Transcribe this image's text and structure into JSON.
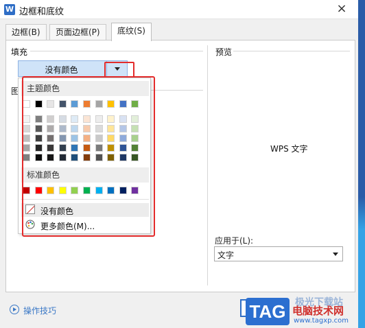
{
  "window": {
    "title": "边框和底纹",
    "app_icon_letter": "W",
    "close_glyph": "×"
  },
  "tabs": [
    {
      "label": "边框(B)",
      "active": false
    },
    {
      "label": "页面边框(P)",
      "active": false
    },
    {
      "label": "底纹(S)",
      "active": true
    }
  ],
  "fill": {
    "section_label": "填充",
    "selected_value": "没有颜色"
  },
  "pattern": {
    "section_label": "图"
  },
  "color_popup": {
    "theme_header": "主题颜色",
    "standard_header": "标准颜色",
    "theme_top_row": [
      "#ffffff",
      "#000000",
      "#e7e6e6",
      "#44546a",
      "#5b9bd5",
      "#ed7d31",
      "#a5a5a5",
      "#ffc000",
      "#4472c4",
      "#70ad47"
    ],
    "theme_shades": [
      [
        "#f2f2f2",
        "#7f7f7f",
        "#d0cece",
        "#d6dce4",
        "#deebf6",
        "#fbe5d5",
        "#ededed",
        "#fff2cc",
        "#d9e2f3",
        "#e2efd9"
      ],
      [
        "#d8d8d8",
        "#595959",
        "#aeabab",
        "#adb9ca",
        "#bdd7ee",
        "#f7caac",
        "#dbdbdb",
        "#ffe598",
        "#b4c6e7",
        "#c5e0b3"
      ],
      [
        "#bfbfbf",
        "#3f3f3f",
        "#757070",
        "#8496b0",
        "#9cc3e5",
        "#f4b083",
        "#c9c9c9",
        "#ffd965",
        "#8eaadb",
        "#a8d08d"
      ],
      [
        "#a5a5a5",
        "#262626",
        "#3a3838",
        "#323f4f",
        "#2e75b5",
        "#c55a11",
        "#7b7b7b",
        "#bf9000",
        "#2f5496",
        "#538135"
      ],
      [
        "#7f7f7f",
        "#0c0c0c",
        "#171616",
        "#222a35",
        "#1f4e79",
        "#843c0b",
        "#525252",
        "#7f6000",
        "#1f3864",
        "#375623"
      ]
    ],
    "standard_colors": [
      "#c00000",
      "#ff0000",
      "#ffc000",
      "#ffff00",
      "#92d050",
      "#00b050",
      "#00b0f0",
      "#0070c0",
      "#002060",
      "#7030a0"
    ],
    "no_color_label": "没有颜色",
    "more_colors_label": "更多颜色(M)..."
  },
  "preview": {
    "section_label": "预览",
    "sample_text": "WPS 文字"
  },
  "apply_to": {
    "label": "应用于(L):",
    "selected_value": "文字"
  },
  "footer": {
    "tips_label": "操作技巧"
  },
  "watermark": {
    "logo_text": "TAG",
    "top_text": "极光下载站",
    "main_text": "电脑技术网",
    "url_text": "www.tagxp.com"
  },
  "colors": {
    "accent_blue": "#2f6ec6",
    "highlight_red": "#e32b2b",
    "select_fill": "#cfe3f8"
  }
}
